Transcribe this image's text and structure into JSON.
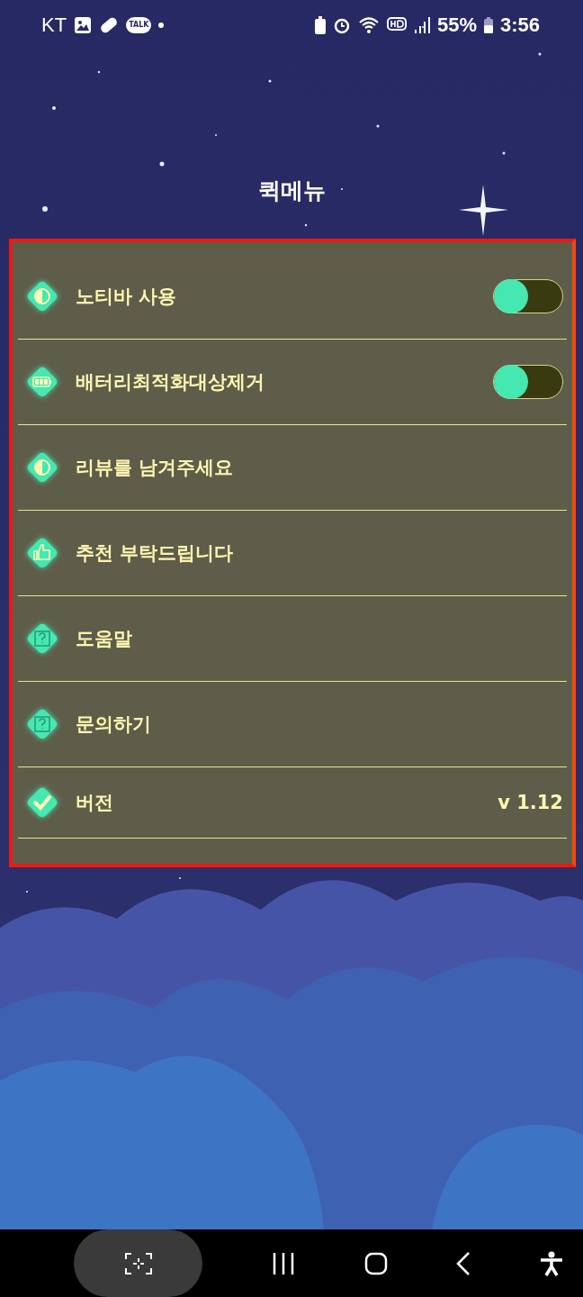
{
  "status_bar": {
    "carrier": "KT",
    "talk_badge": "TALK",
    "battery": "55%",
    "time": "3:56"
  },
  "title": "퀵메뉴",
  "menu": [
    {
      "kind": "toggle",
      "label": "노티바 사용",
      "on": false
    },
    {
      "kind": "toggle",
      "label": "배터리최적화대상제거",
      "on": false
    },
    {
      "kind": "link",
      "label": "리뷰를 남겨주세요"
    },
    {
      "kind": "link",
      "label": "추천 부탁드립니다"
    },
    {
      "kind": "link",
      "label": "도움말"
    },
    {
      "kind": "link",
      "label": "문의하기"
    },
    {
      "kind": "value",
      "label": "버전",
      "value": "v 1.12"
    }
  ]
}
